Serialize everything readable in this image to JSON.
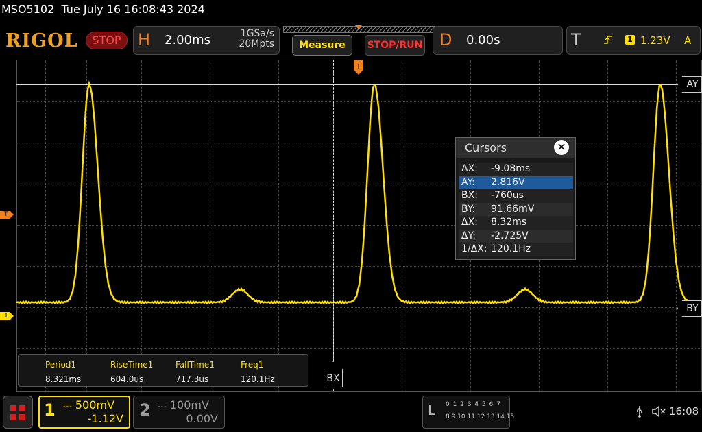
{
  "status": {
    "model": "MSO5102",
    "datetime": "Tue July 16 16:08:43 2024"
  },
  "toolbar": {
    "logo": "RIGOL",
    "run_state": "STOP",
    "horizontal": {
      "letter": "H",
      "timebase": "2.00ms",
      "sample_rate": "1GSa/s",
      "memory_depth": "20Mpts"
    },
    "measure_label": "Measure",
    "stop_run_label": "STOP/RUN",
    "delay": {
      "letter": "D",
      "value": "0.00s"
    },
    "trigger": {
      "letter": "T",
      "source": "1",
      "level": "1.23V",
      "mode": "A"
    }
  },
  "markers": {
    "trigger_level": "T",
    "ch1_ground": "1"
  },
  "cursor_tags": {
    "ay": "AY",
    "by": "BY",
    "bx": "BX"
  },
  "cursors_dialog": {
    "title": "Cursors",
    "close_symbol": "✕",
    "rows": [
      {
        "key": "AX:",
        "value": "-9.08ms"
      },
      {
        "key": "AY:",
        "value": "2.816V"
      },
      {
        "key": "BX:",
        "value": "-760us"
      },
      {
        "key": "BY:",
        "value": "91.66mV"
      },
      {
        "key": "ΔX:",
        "value": "8.32ms"
      },
      {
        "key": "ΔY:",
        "value": "-2.725V"
      },
      {
        "key": "1/ΔX:",
        "value": "120.1Hz"
      }
    ],
    "selected_row": "AY:"
  },
  "measurements": [
    {
      "label": "Period1",
      "value": "8.321ms"
    },
    {
      "label": "RiseTime1",
      "value": "604.0us"
    },
    {
      "label": "FallTime1",
      "value": "717.3us"
    },
    {
      "label": "Freq1",
      "value": "120.1Hz"
    }
  ],
  "channels": {
    "ch1": {
      "number": "1",
      "scale": "500mV",
      "offset": "-1.12V"
    },
    "ch2": {
      "number": "2",
      "scale": "100mV",
      "offset": "0.00V"
    }
  },
  "logic": {
    "letter": "L",
    "row1": "0 1 2 3  4 5 6 7",
    "row2": "8 9 10 11  12 13 14 15"
  },
  "system": {
    "clock": "16:08"
  },
  "colors": {
    "ch1": "#ffe000",
    "trigger": "#f08020",
    "stop": "#ff3030",
    "selection": "#1e5a9c"
  },
  "icons": {
    "menu": "grid-menu-icon",
    "usb": "usb-icon",
    "speaker": "speaker-muted-icon",
    "close": "close-icon",
    "trigger_edge": "rising-edge-icon"
  }
}
